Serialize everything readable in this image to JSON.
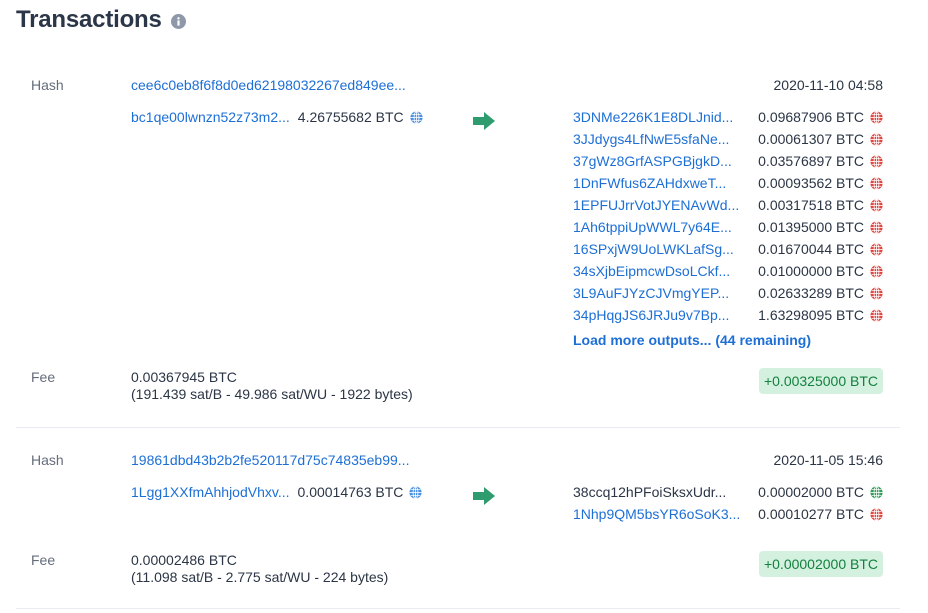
{
  "header": {
    "title": "Transactions",
    "info_icon": "info-circle-icon"
  },
  "transactions": [
    {
      "hash_label": "Hash",
      "hash": "cee6c0eb8f6f8d0ed62198032267ed849ee...",
      "date": "2020-11-10 04:58",
      "inputs": [
        {
          "address": "bc1qe00lwnzn52z73m2...",
          "amount": "4.26755682 BTC",
          "icon": "globe-icon",
          "icon_color": "#4a90e2"
        }
      ],
      "arrow_icon": "arrow-right-icon",
      "arrow_color": "#2e9c6e",
      "outputs": [
        {
          "address": "3DNMe226K1E8DLJnid...",
          "amount": "0.09687906 BTC",
          "icon": "globe-icon",
          "icon_color": "#e0463f",
          "link": true
        },
        {
          "address": "3JJdygs4LfNwE5sfaNe...",
          "amount": "0.00061307 BTC",
          "icon": "globe-icon",
          "icon_color": "#e0463f",
          "link": true
        },
        {
          "address": "37gWz8GrfASPGBjgkD...",
          "amount": "0.03576897 BTC",
          "icon": "globe-icon",
          "icon_color": "#e0463f",
          "link": true
        },
        {
          "address": "1DnFWfus6ZAHdxweT...",
          "amount": "0.00093562 BTC",
          "icon": "globe-icon",
          "icon_color": "#e0463f",
          "link": true
        },
        {
          "address": "1EPFUJrrVotJYENAvWd...",
          "amount": "0.00317518 BTC",
          "icon": "globe-icon",
          "icon_color": "#e0463f",
          "link": true
        },
        {
          "address": "1Ah6tppiUpWWL7y64E...",
          "amount": "0.01395000 BTC",
          "icon": "globe-icon",
          "icon_color": "#e0463f",
          "link": true
        },
        {
          "address": "16SPxjW9UoLWKLafSg...",
          "amount": "0.01670044 BTC",
          "icon": "globe-icon",
          "icon_color": "#e0463f",
          "link": true
        },
        {
          "address": "34sXjbEipmcwDsoLCkf...",
          "amount": "0.01000000 BTC",
          "icon": "globe-icon",
          "icon_color": "#e0463f",
          "link": true
        },
        {
          "address": "3L9AuFJYzCJVmgYEP...",
          "amount": "0.02633289 BTC",
          "icon": "globe-icon",
          "icon_color": "#e0463f",
          "link": true
        },
        {
          "address": "34pHqgJS6JRJu9v7Bp...",
          "amount": "1.63298095 BTC",
          "icon": "globe-icon",
          "icon_color": "#e0463f",
          "link": true
        }
      ],
      "load_more": "Load more outputs... (44 remaining)",
      "fee_label": "Fee",
      "fee": "0.00367945 BTC",
      "fee_detail": "(191.439 sat/B - 49.986 sat/WU - 1922 bytes)",
      "balance_change": "+0.00325000 BTC"
    },
    {
      "hash_label": "Hash",
      "hash": "19861dbd43b2b2fe520117d75c74835eb99...",
      "date": "2020-11-05 15:46",
      "inputs": [
        {
          "address": "1Lgg1XXfmAhhjodVhxv...",
          "amount": "0.00014763 BTC",
          "icon": "globe-icon",
          "icon_color": "#4a90e2"
        }
      ],
      "arrow_icon": "arrow-right-icon",
      "arrow_color": "#2e9c6e",
      "outputs": [
        {
          "address": "38ccq12hPFoiSksxUdr...",
          "amount": "0.00002000 BTC",
          "icon": "globe-icon",
          "icon_color": "#2e9c5a",
          "link": false
        },
        {
          "address": "1Nhp9QM5bsYR6oSoK3...",
          "amount": "0.00010277 BTC",
          "icon": "globe-icon",
          "icon_color": "#e0463f",
          "link": true
        }
      ],
      "fee_label": "Fee",
      "fee": "0.00002486 BTC",
      "fee_detail": "(11.098 sat/B - 2.775 sat/WU - 224 bytes)",
      "balance_change": "+0.00002000 BTC"
    }
  ]
}
